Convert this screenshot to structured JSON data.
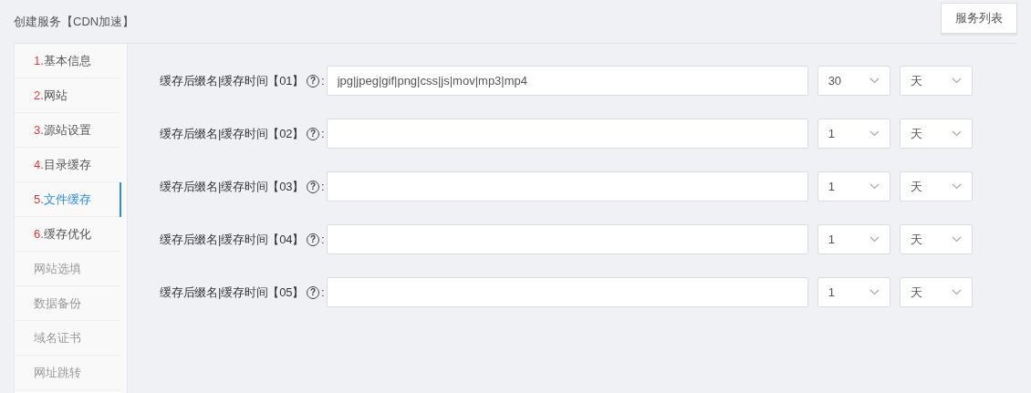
{
  "title": "创建服务【CDN加速】",
  "header_button": "服务列表",
  "sidebar": {
    "items": [
      {
        "number": "1.",
        "label": "基本信息",
        "selected": false,
        "disabled": false
      },
      {
        "number": "2.",
        "label": "网站",
        "selected": false,
        "disabled": false
      },
      {
        "number": "3.",
        "label": "源站设置",
        "selected": false,
        "disabled": false
      },
      {
        "number": "4.",
        "label": "目录缓存",
        "selected": false,
        "disabled": false
      },
      {
        "number": "5.",
        "label": "文件缓存",
        "selected": true,
        "disabled": false
      },
      {
        "number": "6.",
        "label": "缓存优化",
        "selected": false,
        "disabled": false
      },
      {
        "label": "网站选填",
        "selected": false,
        "disabled": true
      },
      {
        "label": "数据备份",
        "selected": false,
        "disabled": true
      },
      {
        "label": "域名证书",
        "selected": false,
        "disabled": true
      },
      {
        "label": "网址跳转",
        "selected": false,
        "disabled": true
      }
    ]
  },
  "rows": [
    {
      "label": "缓存后缀名|缓存时间【01】",
      "help": "?",
      "colon": ":",
      "value": "jpg|jpeg|gif|png|css|js|mov|mp3|mp4",
      "amount": "30",
      "unit": "天"
    },
    {
      "label": "缓存后缀名|缓存时间【02】",
      "help": "?",
      "colon": ":",
      "amount": "1",
      "unit": "天"
    },
    {
      "label": "缓存后缀名|缓存时间【03】",
      "help": "?",
      "colon": ":",
      "amount": "1",
      "unit": "天"
    },
    {
      "label": "缓存后缀名|缓存时间【04】",
      "help": "?",
      "colon": ":",
      "amount": "1",
      "unit": "天"
    },
    {
      "label": "缓存后缀名|缓存时间【05】",
      "help": "?",
      "colon": ":",
      "amount": "1",
      "unit": "天"
    }
  ]
}
